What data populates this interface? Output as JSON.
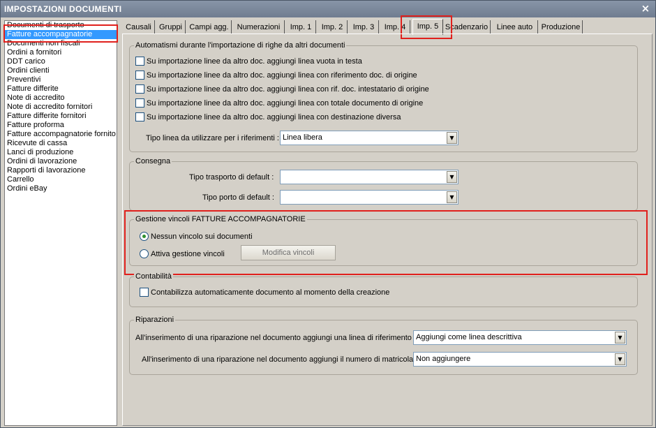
{
  "window": {
    "title": "IMPOSTAZIONI DOCUMENTI",
    "close_glyph": "×"
  },
  "doc_list": {
    "selected_index": 1,
    "items": [
      "Documenti di trasporto",
      "Fatture accompagnatorie",
      "Documenti non fiscali",
      "Ordini a fornitori",
      "DDT carico",
      "Ordini clienti",
      "Preventivi",
      "Fatture differite",
      "Note di accredito",
      "Note di accredito fornitori",
      "Fatture differite fornitori",
      "Fatture proforma",
      "Fatture accompagnatorie fornito",
      "Ricevute di cassa",
      "Lanci di produzione",
      "Ordini di lavorazione",
      "Rapporti di lavorazione",
      "Carrello",
      "Ordini eBay"
    ]
  },
  "tabs": {
    "active": "Imp. 5",
    "items": [
      "Causali",
      "Gruppi",
      "Campi agg.",
      "Numerazioni",
      "Imp. 1",
      "Imp. 2",
      "Imp. 3",
      "Imp. 4",
      "Imp. 5",
      "Scadenzario",
      "Linee auto",
      "Produzione"
    ]
  },
  "automatismi": {
    "title": "Automatismi durante l'importazione di righe da altri documenti",
    "options": [
      {
        "label": "Su importazione linee da altro doc. aggiungi linea vuota in testa",
        "checked": false
      },
      {
        "label": "Su importazione linee da altro doc. aggiungi linea con riferimento doc. di origine",
        "checked": false
      },
      {
        "label": "Su importazione linee da altro doc. aggiungi linea con rif. doc. intestatario di origine",
        "checked": false
      },
      {
        "label": "Su importazione linee da altro doc. aggiungi linea con totale documento di origine",
        "checked": false
      },
      {
        "label": "Su importazione linee da altro doc. aggiungi linea con destinazione diversa",
        "checked": false
      }
    ],
    "tipo_linea_label": "Tipo linea da utilizzare per i riferimenti :",
    "tipo_linea_value": "Linea libera"
  },
  "consegna": {
    "title": "Consegna",
    "trasporto_label": "Tipo trasporto di default :",
    "trasporto_value": "",
    "porto_label": "Tipo porto di default :",
    "porto_value": ""
  },
  "vincoli": {
    "title": "Gestione vincoli FATTURE ACCOMPAGNATORIE",
    "option_none": "Nessun vincolo sui documenti",
    "option_active": "Attiva gestione vincoli",
    "selected": "none",
    "modify_button": "Modifica vincoli"
  },
  "contabilita": {
    "title": "Contabilità",
    "option": "Contabilizza automaticamente documento al momento della creazione",
    "checked": false
  },
  "riparazioni": {
    "title": "Riparazioni",
    "riferimento_label": "All'inserimento di una riparazione nel documento aggiungi una linea di riferimento :",
    "riferimento_value": "Aggiungi come linea descrittiva",
    "matricola_label": "All'inserimento di una riparazione nel documento aggiungi il numero di matricola :",
    "matricola_value": "Non aggiungere"
  },
  "colors": {
    "highlight_box": "#e0201c",
    "selection": "#3399ff",
    "titlebar": "#7a879b"
  },
  "icons": {
    "close": "close-icon",
    "dropdown": "chevron-down-icon"
  }
}
